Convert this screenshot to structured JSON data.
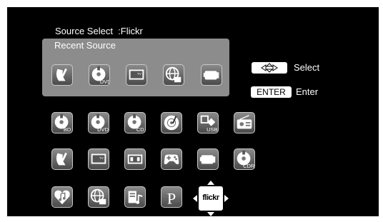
{
  "header": {
    "title": "Source Select  :Flickr"
  },
  "recent": {
    "title": "Recent Source",
    "items": [
      {
        "icon": "satellite-dish-icon"
      },
      {
        "icon": "dvd-icon",
        "label": "DVD"
      },
      {
        "icon": "tv-icon",
        "label": "TV"
      },
      {
        "icon": "internet-globe-icon"
      },
      {
        "icon": "camcorder-icon"
      }
    ]
  },
  "hints": {
    "select_label": "Select",
    "enter_key": "ENTER",
    "enter_label": "Enter"
  },
  "sources": [
    {
      "icon": "bd-disc-icon",
      "label": "BD"
    },
    {
      "icon": "dvd-icon",
      "label": "DVD"
    },
    {
      "icon": "cd-icon",
      "label": "CD"
    },
    {
      "icon": "turntable-icon"
    },
    {
      "icon": "usb-icon",
      "label": "USB"
    },
    {
      "icon": "radio-icon"
    },
    {
      "icon": "satellite-dish-icon"
    },
    {
      "icon": "tv-icon",
      "label": "TV"
    },
    {
      "icon": "vcr-icon"
    },
    {
      "icon": "game-controller-icon"
    },
    {
      "icon": "camcorder-icon"
    },
    {
      "icon": "cdr-disc-icon",
      "label": "CDR"
    },
    {
      "icon": "music-heart-icon"
    },
    {
      "icon": "internet-globe-icon"
    },
    {
      "icon": "music-server-icon"
    },
    {
      "icon": "pandora-icon",
      "label": "P"
    },
    {
      "icon": "flickr-icon",
      "label": "flickr"
    }
  ]
}
